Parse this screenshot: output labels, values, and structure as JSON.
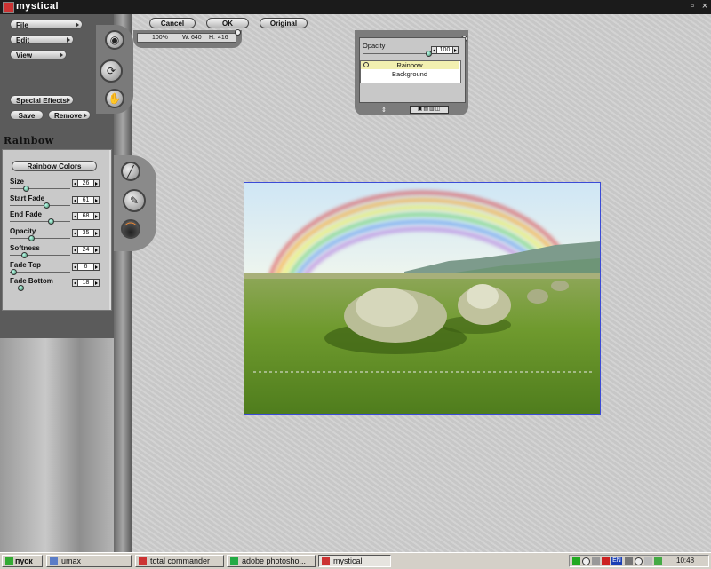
{
  "window": {
    "title": "mystical"
  },
  "menu": {
    "file": "File",
    "edit": "Edit",
    "view": "View",
    "special_effects": "Special Effects",
    "save": "Save",
    "remove": "Remove"
  },
  "toolbar": {
    "cancel": "Cancel",
    "ok": "OK",
    "original": "Original"
  },
  "info": {
    "zoom": "100%",
    "w_label": "W:",
    "w_value": "640",
    "h_label": "H:",
    "h_value": "416"
  },
  "effect": {
    "title": "Rainbow",
    "preset_button": "Rainbow Colors",
    "settings": [
      {
        "label": "Size",
        "value": "26",
        "slider": 0.26
      },
      {
        "label": "Start Fade",
        "value": "61",
        "slider": 0.61
      },
      {
        "label": "End Fade",
        "value": "68",
        "slider": 0.68
      },
      {
        "label": "Opacity",
        "value": "35",
        "slider": 0.35
      },
      {
        "label": "Softness",
        "value": "24",
        "slider": 0.24
      },
      {
        "label": "Fade Top",
        "value": "6",
        "slider": 0.06
      },
      {
        "label": "Fade Bottom",
        "value": "18",
        "slider": 0.18
      }
    ]
  },
  "layers_panel": {
    "opacity_label": "Opacity",
    "opacity_value": "100",
    "layers": [
      "Rainbow",
      "Background"
    ]
  },
  "taskbar": {
    "start": "пуск",
    "tasks": [
      "umax",
      "total commander",
      "adobe photosho...",
      "mystical"
    ],
    "lang": "EN",
    "clock": "10:48"
  },
  "colors": {
    "accent_blue": "#3b4bd6",
    "selected_layer": "#f2f0b0"
  }
}
